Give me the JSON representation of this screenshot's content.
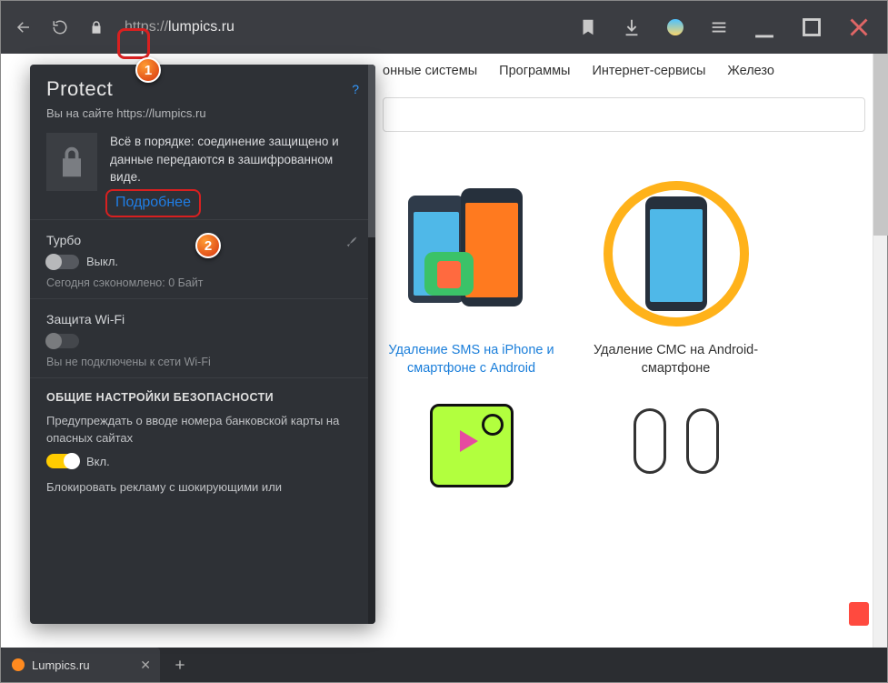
{
  "browser": {
    "url_protocol": "https://",
    "url_host": "lumpics.ru",
    "address_display": "https://lumpics.ru"
  },
  "protect": {
    "title": "Protect",
    "help": "?",
    "site_line": "Вы на сайте https://lumpics.ru",
    "security_text": "Всё в порядке: соединение защищено и данные передаются в зашифрованном виде.",
    "more": "Подробнее",
    "turbo": {
      "label": "Турбо",
      "state": "Выкл.",
      "saved": "Сегодня сэкономлено: 0 Байт"
    },
    "wifi": {
      "label": "Защита Wi-Fi",
      "status": "Вы не подключены к сети Wi-Fi"
    },
    "general": {
      "heading": "ОБЩИЕ НАСТРОЙКИ БЕЗОПАСНОСТИ",
      "warn_card": "Предупреждать о вводе номера банковской карты на опасных сайтах",
      "warn_card_state": "Вкл.",
      "block_ads": "Блокировать рекламу с шокирующими или"
    }
  },
  "site": {
    "nav": [
      "онные системы",
      "Программы",
      "Интернет-сервисы",
      "Железо"
    ],
    "cards": [
      {
        "title": "Удаление SMS на iPhone и смартфоне с Android"
      },
      {
        "title": "Удаление СМС на Android-смартфоне"
      }
    ]
  },
  "tab": {
    "title": "Lumpics.ru"
  },
  "callouts": {
    "one": "1",
    "two": "2"
  }
}
